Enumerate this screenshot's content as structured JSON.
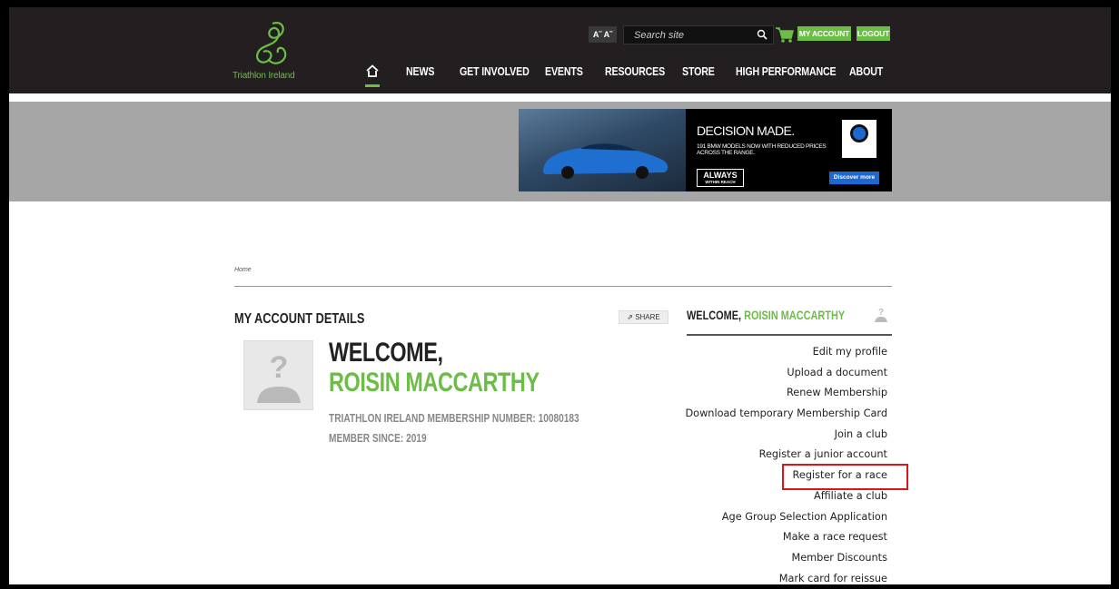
{
  "header": {
    "logo_text": "Triathlon Ireland",
    "font_size_label": "A˜ A˜",
    "search_placeholder": "Search site",
    "my_account": "MY ACCOUNT",
    "logout": "LOGOUT",
    "nav": [
      "NEWS",
      "GET INVOLVED",
      "EVENTS",
      "RESOURCES",
      "STORE",
      "HIGH PERFORMANCE",
      "ABOUT"
    ]
  },
  "ad": {
    "title": "DECISION MADE.",
    "subtitle": "191 BMW MODELS NOW WITH REDUCED PRICES ACROSS THE RANGE.",
    "always": "ALWAYS",
    "always_small": "WITHIN REACH",
    "cta": "Discover more"
  },
  "breadcrumb": "Home",
  "account": {
    "section_title": "MY ACCOUNT DETAILS",
    "share": "SHARE",
    "welcome": "WELCOME,",
    "name": "ROISIN MACCARTHY",
    "membership": "TRIATHLON IRELAND MEMBERSHIP NUMBER: 10080183",
    "since": "MEMBER SINCE: 2019"
  },
  "sidebar": {
    "welcome": "WELCOME,",
    "name": "ROISIN MACCARTHY",
    "items": [
      "Edit my profile",
      "Upload a document",
      "Renew Membership",
      "Download temporary Membership Card",
      "Join a club",
      "Register a junior account",
      "Register for a race",
      "Affiliate a club",
      "Age Group Selection Application",
      "Make a race request",
      "Member Discounts",
      "Mark card for reissue"
    ]
  },
  "colors": {
    "brand_green": "#6cbd45",
    "header_bg": "#231f20",
    "highlight": "#e0131a"
  }
}
